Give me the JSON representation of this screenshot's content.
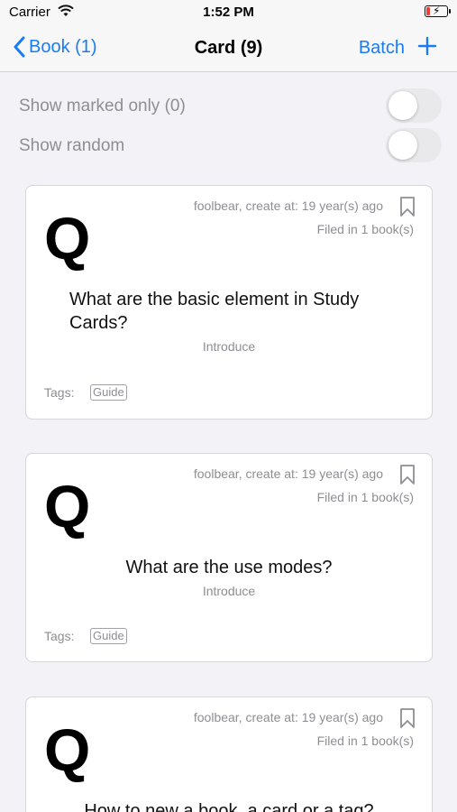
{
  "status_bar": {
    "carrier": "Carrier",
    "time": "1:52 PM"
  },
  "nav": {
    "back_label": "Book (1)",
    "title": "Card (9)",
    "batch_label": "Batch",
    "accent_color": "#1a7cf5"
  },
  "filters": [
    {
      "label": "Show marked only (0)",
      "on": false
    },
    {
      "label": "Show random",
      "on": false
    }
  ],
  "cards": [
    {
      "meta": "foolbear, create at: 19 year(s) ago",
      "filed": "Filed in 1 book(s)",
      "q_letter": "Q",
      "question": "What are the basic element in Study Cards?",
      "subtitle": "Introduce",
      "tags_label": "Tags:",
      "tag": "Guide"
    },
    {
      "meta": "foolbear, create at: 19 year(s) ago",
      "filed": "Filed in 1 book(s)",
      "q_letter": "Q",
      "question": "What are the use modes?",
      "subtitle": "Introduce",
      "tags_label": "Tags:",
      "tag": "Guide"
    },
    {
      "meta": "foolbear, create at: 19 year(s) ago",
      "filed": "Filed in 1 book(s)",
      "q_letter": "Q",
      "question": "How to new a book, a card or a tag?"
    }
  ]
}
